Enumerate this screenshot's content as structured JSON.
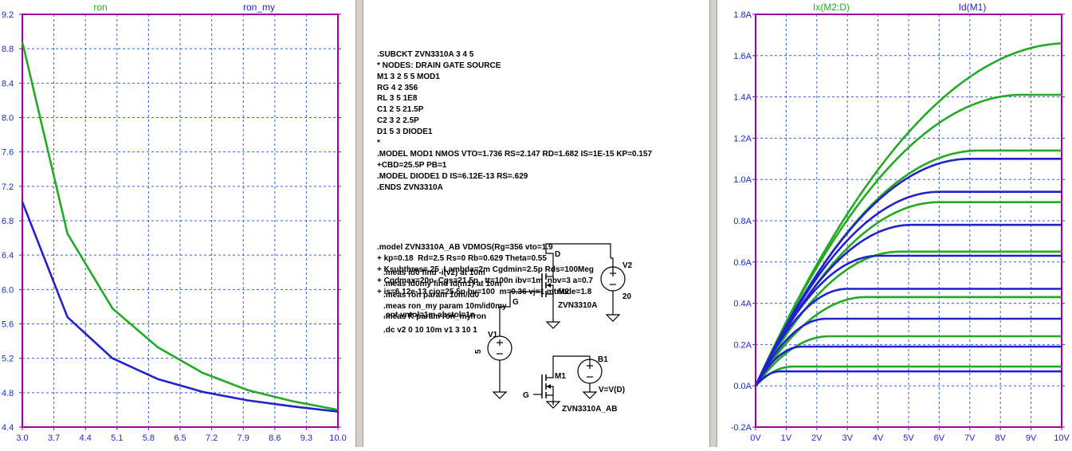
{
  "left_plot": {
    "legend": [
      {
        "name": "ron",
        "color": "#22aa22"
      },
      {
        "name": "ron_my",
        "color": "#2222cc"
      }
    ],
    "y_ticks": [
      "9.2",
      "8.8",
      "8.4",
      "8.0",
      "7.6",
      "7.2",
      "6.8",
      "6.4",
      "6.0",
      "5.6",
      "5.2",
      "4.8",
      "4.4"
    ],
    "x_ticks": [
      "3.0",
      "3.7",
      "4.4",
      "5.1",
      "5.8",
      "6.5",
      "7.2",
      "7.9",
      "8.6",
      "9.3",
      "10.0"
    ]
  },
  "right_plot": {
    "legend": [
      {
        "name": "Ix(M2:D)",
        "color": "#22aa22"
      },
      {
        "name": "Id(M1)",
        "color": "#2222cc"
      }
    ],
    "y_ticks": [
      "1.8A",
      "1.6A",
      "1.4A",
      "1.2A",
      "1.0A",
      "0.8A",
      "0.6A",
      "0.4A",
      "0.2A",
      "0.0A",
      "-0.2A"
    ],
    "x_ticks": [
      "0V",
      "1V",
      "2V",
      "3V",
      "4V",
      "5V",
      "6V",
      "7V",
      "8V",
      "9V",
      "10V"
    ]
  },
  "netlist": {
    "subckt": [
      ".SUBCKT ZVN3310A 3 4 5",
      "* NODES: DRAIN GATE SOURCE",
      "M1 3 2 5 5 MOD1",
      "RG 4 2 356",
      "RL 3 5 1E8",
      "C1 2 5 21.5P",
      "C2 3 2 2.5P",
      "D1 5 3 DIODE1",
      "*",
      ".MODEL MOD1 NMOS VTO=1.736 RS=2.147 RD=1.682 IS=1E-15 KP=0.157",
      "+CBD=25.5P PB=1",
      ".MODEL DIODE1 D IS=6.12E-13 RS=.629",
      ".ENDS ZVN3310A"
    ],
    "vdmos": [
      ".model ZVN3310A_AB VDMOS(Rg=356 vto=1.9",
      "+ kp=0.18  Rd=2.5 Rs=0 Rb=0.629 Theta=0.55",
      "+ Ksubthres=.25  Lambda=2m Cgdmin=2.5p Rds=100Meg",
      "+ Cgdmax=20p  Cgs=21.5p   tt=100n ibv=1m  nbv=3 a=0.7",
      "+ is=6.12e-13 cjo=25.5p bv=100  m=0.36 vj=1 mtriode=1.8"
    ],
    "meas": [
      ".meas id0 find -i(v2) at 10m",
      ".meas id0my find id(m1) at 10m",
      ".meas ron param 10m/id0",
      ".meas ron_my param 10m/id0my",
      ".meas K param ron_my/ron"
    ],
    "opt": ".opt vntol=1m abstol=1n",
    "dc": ".dc v2 0 10 10m v1 3 10 1"
  },
  "schematic": {
    "net_d": "D",
    "net_g": "G",
    "net_g2": "G",
    "v2_name": "V2",
    "v2_value": "20",
    "v1_name": "V1",
    "v1_value": "5",
    "m2_name": "M2",
    "m2_model": "ZVN3310A",
    "m1_name": "M1",
    "m1_model": "ZVN3310A_AB",
    "b1_name": "B1",
    "b1_value": "V=V(D)"
  },
  "chart_data": [
    {
      "type": "line",
      "x": [
        3.0,
        4.0,
        5.0,
        6.0,
        7.0,
        8.0,
        9.0,
        10.0
      ],
      "series": [
        {
          "name": "ron",
          "color": "#22aa22",
          "values": [
            8.88,
            6.65,
            5.78,
            5.33,
            5.03,
            4.83,
            4.7,
            4.6
          ]
        },
        {
          "name": "ron_my",
          "color": "#2222cc",
          "values": [
            7.02,
            5.68,
            5.2,
            4.96,
            4.81,
            4.71,
            4.64,
            4.58
          ]
        }
      ],
      "xlim": [
        3.0,
        10.0
      ],
      "ylim": [
        4.4,
        9.2
      ],
      "grid": true,
      "legend": "top"
    },
    {
      "type": "line",
      "xlim": [
        0,
        10
      ],
      "ylim": [
        -0.2,
        1.8
      ],
      "grid": true,
      "legend": "top",
      "series": [
        {
          "name": "Ix(M2:D)",
          "color": "#22aa22",
          "families": [
            {
              "vgs": 3,
              "sat": 0.093,
              "knee": 1.2
            },
            {
              "vgs": 4,
              "sat": 0.24,
              "knee": 2.4
            },
            {
              "vgs": 5,
              "sat": 0.43,
              "knee": 3.6
            },
            {
              "vgs": 6,
              "sat": 0.65,
              "knee": 4.7
            },
            {
              "vgs": 7,
              "sat": 0.89,
              "knee": 6.0
            },
            {
              "vgs": 8,
              "sat": 1.14,
              "knee": 7.3
            },
            {
              "vgs": 9,
              "sat": 1.41,
              "knee": 8.7
            },
            {
              "vgs": 10,
              "sat": 1.66,
              "knee": 10.2
            }
          ]
        },
        {
          "name": "Id(M1)",
          "color": "#2222cc",
          "families": [
            {
              "vgs": 3,
              "sat": 0.07,
              "knee": 0.8
            },
            {
              "vgs": 4,
              "sat": 0.19,
              "knee": 1.5
            },
            {
              "vgs": 5,
              "sat": 0.325,
              "knee": 2.3
            },
            {
              "vgs": 6,
              "sat": 0.47,
              "knee": 3.0
            },
            {
              "vgs": 7,
              "sat": 0.63,
              "knee": 4.0
            },
            {
              "vgs": 8,
              "sat": 0.78,
              "knee": 5.1
            },
            {
              "vgs": 9,
              "sat": 0.94,
              "knee": 6.0
            },
            {
              "vgs": 10,
              "sat": 1.1,
              "knee": 7.0
            }
          ]
        }
      ]
    }
  ]
}
